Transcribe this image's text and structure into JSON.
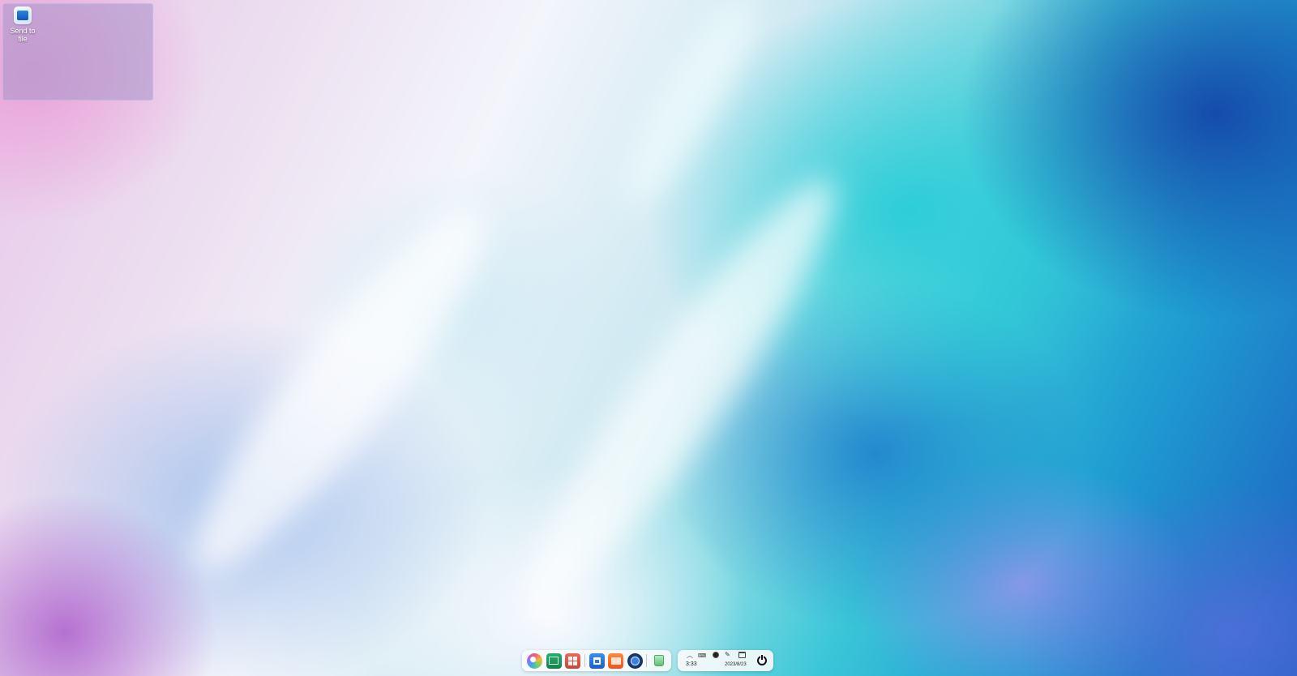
{
  "desktop": {
    "icons": [
      {
        "label": "Send to file",
        "icon": "image-viewer-icon"
      }
    ]
  },
  "dock": {
    "apps": [
      {
        "name": "launcher",
        "icon": "launcher-icon"
      },
      {
        "name": "system-monitor",
        "icon": "system-monitor-icon"
      },
      {
        "name": "multitasking-view",
        "icon": "multitask-icon"
      },
      {
        "name": "app-store",
        "icon": "app-store-icon"
      },
      {
        "name": "file-manager",
        "icon": "folder-icon"
      },
      {
        "name": "browser",
        "icon": "browser-icon"
      },
      {
        "name": "trash",
        "icon": "trash-icon"
      }
    ]
  },
  "tray": {
    "time": "3:33",
    "date": "2023/8/23",
    "keyboard_label": "⌨",
    "icons": [
      "chevron-up-icon",
      "keyboard-icon",
      "network-icon",
      "pen-icon",
      "calendar-icon",
      "power-icon"
    ]
  }
}
